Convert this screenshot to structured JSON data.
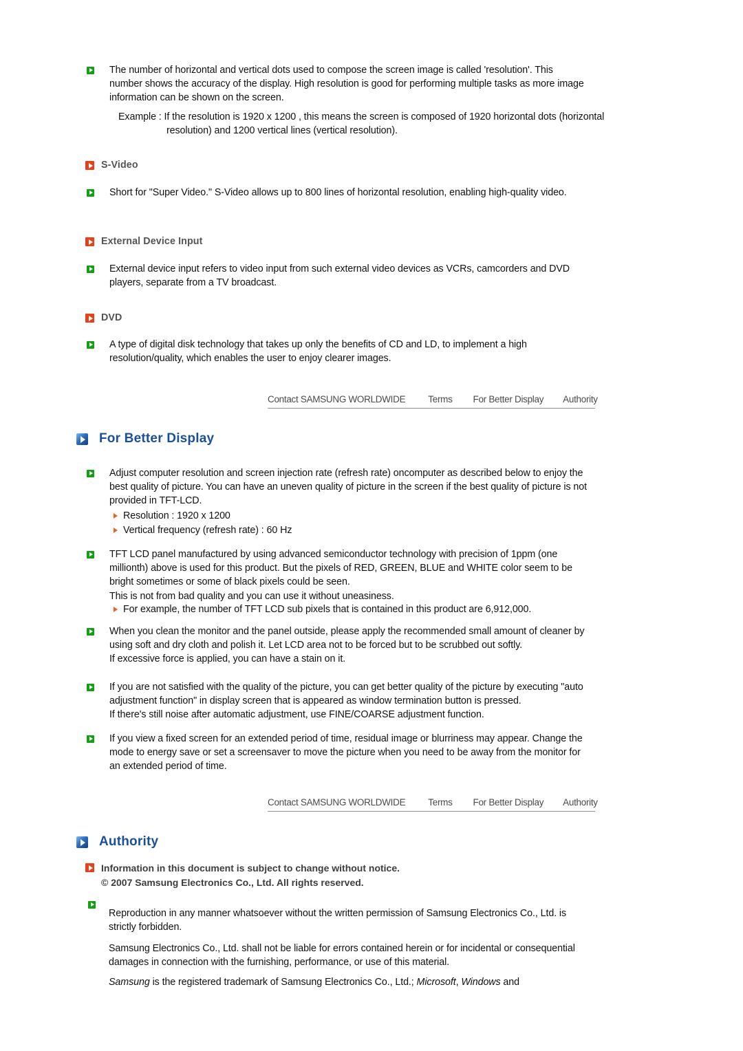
{
  "document": {
    "title": "Samsung Monitor User Manual - Information / For Better Display / Authority"
  },
  "resolution_section": {
    "paragraph": "The number of horizontal and vertical dots used to compose the screen image is called 'resolution'. This number shows the accuracy of the display. High resolution is good for performing multiple tasks as more image information can be shown on the screen.",
    "example": "Example : If the resolution is 1920 x 1200 , this means the screen is composed of 1920 horizontal dots (horizontal resolution) and 1200 vertical lines (vertical resolution)."
  },
  "svideo": {
    "heading": "S-Video",
    "paragraph": "Short for \"Super Video.\" S-Video allows up to 800 lines of horizontal resolution, enabling high-quality video."
  },
  "external_device_input": {
    "heading": "External Device Input",
    "paragraph": "External device input refers to video input from such external video devices as VCRs, camcorders and DVD players, separate from a TV broadcast."
  },
  "dvd": {
    "heading": "DVD",
    "paragraph": "A type of digital disk technology that takes up only the benefits of CD and LD, to implement a high resolution/quality, which enables the user to enjoy clearer images."
  },
  "nav": {
    "items": [
      {
        "label": "Contact SAMSUNG WORLDWIDE"
      },
      {
        "label": "Terms"
      },
      {
        "label": "For Better Display"
      },
      {
        "label": "Authority"
      }
    ]
  },
  "for_better_display": {
    "heading": "For Better Display",
    "p1": "Adjust computer resolution and screen injection rate (refresh rate) oncomputer as described below to enjoy the best quality of picture. You can have an uneven quality of picture in the screen if the best quality of picture is not provided in TFT-LCD.",
    "specs": [
      "Resolution : 1920 x 1200",
      "Vertical frequency (refresh rate) : 60 Hz"
    ],
    "p2": "TFT LCD panel manufactured by using advanced semiconductor technology with precision of 1ppm (one millionth) above is used for this product. But the pixels of RED, GREEN, BLUE and WHITE color seem to be bright sometimes or some of black pixels could be seen.",
    "p2b": "This is not from bad quality and you can use it without uneasiness.",
    "subpixels": "For example, the number of TFT LCD sub pixels that is contained in this product are 6,912,000.",
    "p3": "When you clean the monitor and the panel outside, please apply the recommended small amount of cleaner by using soft and dry cloth and polish it. Let LCD area not to be forced but to be scrubbed out softly.",
    "p3b": "If excessive force is applied, you can have a stain on it.",
    "p4": "If you are not satisfied with the quality of the picture, you can get better quality of the picture by executing \"auto adjustment function\" in display screen that is appeared as window termination button is pressed.",
    "p4b": "If there's still noise after automatic adjustment, use FINE/COARSE adjustment function.",
    "p5": "If you view a fixed screen for an extended period of time, residual image or blurriness may appear. Change the mode to energy save or set a screensaver to move the picture when you need to be away from the monitor for an extended period of time."
  },
  "authority": {
    "heading": "Authority",
    "notice_line1": "Information in this document is subject to change without notice.",
    "notice_line2": "© 2007 Samsung Electronics Co., Ltd. All rights reserved.",
    "p1": "Reproduction in any manner whatsoever without the written permission of Samsung Electronics Co., Ltd. is strictly forbidden.",
    "p2": "Samsung Electronics Co., Ltd. shall not be liable for errors contained herein or for incidental or consequential damages in connection with the furnishing, performance, or use of this material.",
    "trademark": {
      "a": "Samsung",
      "b": " is the registered trademark of Samsung Electronics Co., Ltd.; ",
      "c": "Microsoft",
      "d": ", ",
      "e": "Windows",
      "f": " and"
    }
  },
  "colors": {
    "green_bullet": "#14a014",
    "orange_bullet": "#e8401a",
    "blue_heading": "#1a4f9c",
    "sub_heading_gray": "#555555",
    "nav_text": "#4a4a4a",
    "nav_rule": "#8c8c8c"
  }
}
